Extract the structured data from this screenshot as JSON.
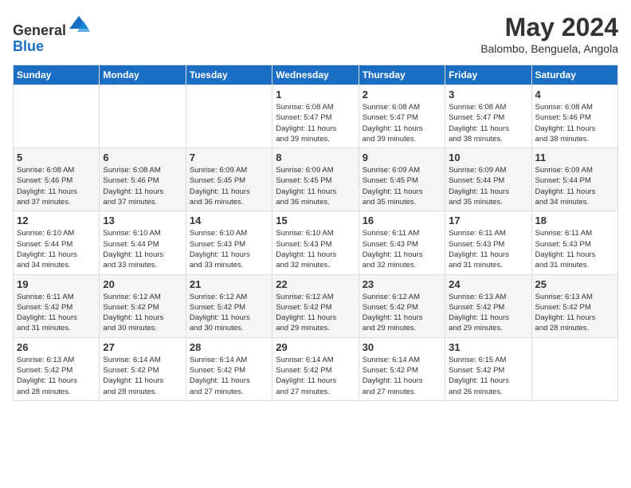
{
  "header": {
    "logo_line1": "General",
    "logo_line2": "Blue",
    "month_title": "May 2024",
    "location": "Balombo, Benguela, Angola"
  },
  "weekdays": [
    "Sunday",
    "Monday",
    "Tuesday",
    "Wednesday",
    "Thursday",
    "Friday",
    "Saturday"
  ],
  "weeks": [
    [
      {
        "day": "",
        "info": ""
      },
      {
        "day": "",
        "info": ""
      },
      {
        "day": "",
        "info": ""
      },
      {
        "day": "1",
        "info": "Sunrise: 6:08 AM\nSunset: 5:47 PM\nDaylight: 11 hours\nand 39 minutes."
      },
      {
        "day": "2",
        "info": "Sunrise: 6:08 AM\nSunset: 5:47 PM\nDaylight: 11 hours\nand 39 minutes."
      },
      {
        "day": "3",
        "info": "Sunrise: 6:08 AM\nSunset: 5:47 PM\nDaylight: 11 hours\nand 38 minutes."
      },
      {
        "day": "4",
        "info": "Sunrise: 6:08 AM\nSunset: 5:46 PM\nDaylight: 11 hours\nand 38 minutes."
      }
    ],
    [
      {
        "day": "5",
        "info": "Sunrise: 6:08 AM\nSunset: 5:46 PM\nDaylight: 11 hours\nand 37 minutes."
      },
      {
        "day": "6",
        "info": "Sunrise: 6:08 AM\nSunset: 5:46 PM\nDaylight: 11 hours\nand 37 minutes."
      },
      {
        "day": "7",
        "info": "Sunrise: 6:09 AM\nSunset: 5:45 PM\nDaylight: 11 hours\nand 36 minutes."
      },
      {
        "day": "8",
        "info": "Sunrise: 6:09 AM\nSunset: 5:45 PM\nDaylight: 11 hours\nand 36 minutes."
      },
      {
        "day": "9",
        "info": "Sunrise: 6:09 AM\nSunset: 5:45 PM\nDaylight: 11 hours\nand 35 minutes."
      },
      {
        "day": "10",
        "info": "Sunrise: 6:09 AM\nSunset: 5:44 PM\nDaylight: 11 hours\nand 35 minutes."
      },
      {
        "day": "11",
        "info": "Sunrise: 6:09 AM\nSunset: 5:44 PM\nDaylight: 11 hours\nand 34 minutes."
      }
    ],
    [
      {
        "day": "12",
        "info": "Sunrise: 6:10 AM\nSunset: 5:44 PM\nDaylight: 11 hours\nand 34 minutes."
      },
      {
        "day": "13",
        "info": "Sunrise: 6:10 AM\nSunset: 5:44 PM\nDaylight: 11 hours\nand 33 minutes."
      },
      {
        "day": "14",
        "info": "Sunrise: 6:10 AM\nSunset: 5:43 PM\nDaylight: 11 hours\nand 33 minutes."
      },
      {
        "day": "15",
        "info": "Sunrise: 6:10 AM\nSunset: 5:43 PM\nDaylight: 11 hours\nand 32 minutes."
      },
      {
        "day": "16",
        "info": "Sunrise: 6:11 AM\nSunset: 5:43 PM\nDaylight: 11 hours\nand 32 minutes."
      },
      {
        "day": "17",
        "info": "Sunrise: 6:11 AM\nSunset: 5:43 PM\nDaylight: 11 hours\nand 31 minutes."
      },
      {
        "day": "18",
        "info": "Sunrise: 6:11 AM\nSunset: 5:43 PM\nDaylight: 11 hours\nand 31 minutes."
      }
    ],
    [
      {
        "day": "19",
        "info": "Sunrise: 6:11 AM\nSunset: 5:42 PM\nDaylight: 11 hours\nand 31 minutes."
      },
      {
        "day": "20",
        "info": "Sunrise: 6:12 AM\nSunset: 5:42 PM\nDaylight: 11 hours\nand 30 minutes."
      },
      {
        "day": "21",
        "info": "Sunrise: 6:12 AM\nSunset: 5:42 PM\nDaylight: 11 hours\nand 30 minutes."
      },
      {
        "day": "22",
        "info": "Sunrise: 6:12 AM\nSunset: 5:42 PM\nDaylight: 11 hours\nand 29 minutes."
      },
      {
        "day": "23",
        "info": "Sunrise: 6:12 AM\nSunset: 5:42 PM\nDaylight: 11 hours\nand 29 minutes."
      },
      {
        "day": "24",
        "info": "Sunrise: 6:13 AM\nSunset: 5:42 PM\nDaylight: 11 hours\nand 29 minutes."
      },
      {
        "day": "25",
        "info": "Sunrise: 6:13 AM\nSunset: 5:42 PM\nDaylight: 11 hours\nand 28 minutes."
      }
    ],
    [
      {
        "day": "26",
        "info": "Sunrise: 6:13 AM\nSunset: 5:42 PM\nDaylight: 11 hours\nand 28 minutes."
      },
      {
        "day": "27",
        "info": "Sunrise: 6:14 AM\nSunset: 5:42 PM\nDaylight: 11 hours\nand 28 minutes."
      },
      {
        "day": "28",
        "info": "Sunrise: 6:14 AM\nSunset: 5:42 PM\nDaylight: 11 hours\nand 27 minutes."
      },
      {
        "day": "29",
        "info": "Sunrise: 6:14 AM\nSunset: 5:42 PM\nDaylight: 11 hours\nand 27 minutes."
      },
      {
        "day": "30",
        "info": "Sunrise: 6:14 AM\nSunset: 5:42 PM\nDaylight: 11 hours\nand 27 minutes."
      },
      {
        "day": "31",
        "info": "Sunrise: 6:15 AM\nSunset: 5:42 PM\nDaylight: 11 hours\nand 26 minutes."
      },
      {
        "day": "",
        "info": ""
      }
    ]
  ]
}
